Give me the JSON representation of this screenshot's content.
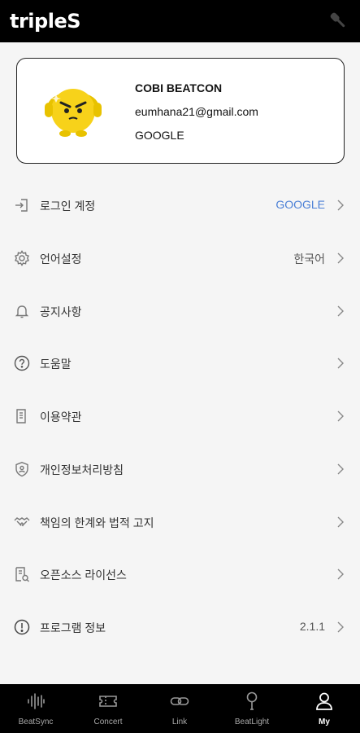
{
  "header": {
    "logo": "tripleS",
    "right_icon": "lightstick-icon"
  },
  "profile": {
    "name": "COBI BEATCON",
    "email": "eumhana21@gmail.com",
    "provider": "GOOGLE"
  },
  "menu": [
    {
      "icon": "login-icon",
      "label": "로그인 계정",
      "value": "GOOGLE"
    },
    {
      "icon": "gear-icon",
      "label": "언어설정",
      "value": "한국어"
    },
    {
      "icon": "bell-icon",
      "label": "공지사항",
      "value": ""
    },
    {
      "icon": "help-icon",
      "label": "도움말",
      "value": ""
    },
    {
      "icon": "document-icon",
      "label": "이용약관",
      "value": ""
    },
    {
      "icon": "shield-icon",
      "label": "개인정보처리방침",
      "value": ""
    },
    {
      "icon": "handshake-icon",
      "label": "책임의 한계와 법적 고지",
      "value": ""
    },
    {
      "icon": "license-icon",
      "label": "오픈소스 라이선스",
      "value": ""
    },
    {
      "icon": "info-icon",
      "label": "프로그램 정보",
      "value": "2.1.1"
    }
  ],
  "colors": {
    "accent_blue": "#4a7fd6",
    "bar_black": "#000000",
    "background": "#f5f5f5"
  },
  "bottom_nav": [
    {
      "icon": "waveform-icon",
      "label": "BeatSync"
    },
    {
      "icon": "ticket-icon",
      "label": "Concert"
    },
    {
      "icon": "link-icon",
      "label": "Link"
    },
    {
      "icon": "lightstick-icon",
      "label": "BeatLight"
    },
    {
      "icon": "person-icon",
      "label": "My",
      "active": true
    }
  ]
}
